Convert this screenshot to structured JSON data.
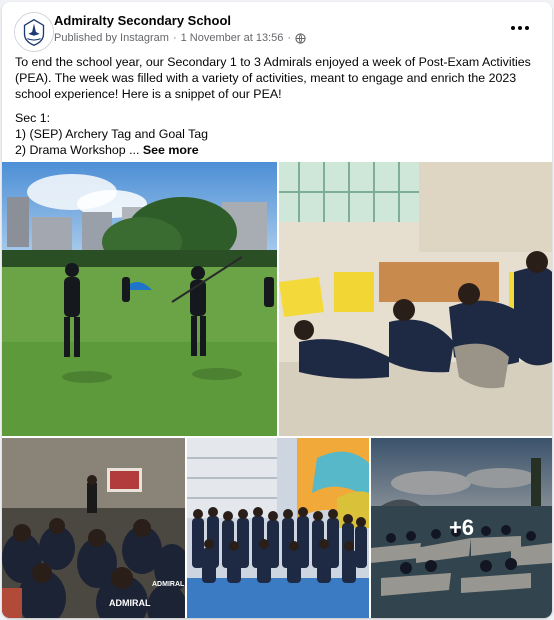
{
  "post": {
    "page_name": "Admiralty Secondary School",
    "published_by": "Published by Instagram",
    "date": "1 November at 13:56",
    "more_icon": "more-horizontal-icon",
    "privacy_icon": "globe-icon",
    "text": {
      "paragraph1": "To end the school year, our Secondary 1 to 3 Admirals enjoyed a week of Post-Exam Activities (PEA). The week was filled with a variety of activities, meant to engage and enrich the 2023 school experience! Here is a snippet of our PEA!",
      "sec_heading": "Sec 1:",
      "item1": "1) (SEP) Archery Tag and Goal Tag",
      "item2": "2) Drama Workshop ...",
      "see_more": "See more"
    },
    "photos": {
      "more_count": "+6",
      "shirt_text_1": "ADMIRAL",
      "shirt_text_2": "ADMIRAL"
    }
  },
  "colors": {
    "background": "#f0f2f5",
    "card": "#ffffff",
    "secondary_text": "#65676b",
    "primary_text": "#050505"
  }
}
